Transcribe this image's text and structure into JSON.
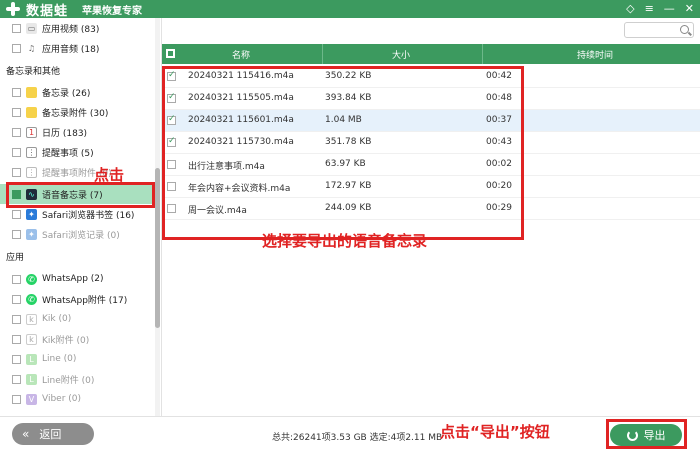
{
  "titlebar": {
    "app_name": "数据蛙",
    "subtitle": "苹果恢复专家",
    "icons": [
      "diamond-icon",
      "menu-icon",
      "minimize-icon",
      "close-icon"
    ]
  },
  "sidebar": {
    "top_items": [
      {
        "label": "应用视频 (83)"
      },
      {
        "label": "应用音频 (18)"
      }
    ],
    "section_memo": "备忘录和其他",
    "memo_items": [
      {
        "label": "备忘录 (26)",
        "gray": false
      },
      {
        "label": "备忘录附件 (30)",
        "gray": false
      },
      {
        "label": "日历 (183)",
        "gray": false
      },
      {
        "label": "提醒事项 (5)",
        "gray": false
      },
      {
        "label": "提醒事项附件 (0)",
        "gray": true
      },
      {
        "label": "语音备忘录 (7)",
        "gray": false,
        "selected": true
      },
      {
        "label": "Safari浏览器书签 (16)",
        "gray": false
      },
      {
        "label": "Safari浏览记录 (0)",
        "gray": true
      }
    ],
    "section_apps": "应用",
    "app_items": [
      {
        "label": "WhatsApp (2)",
        "gray": false
      },
      {
        "label": "WhatsApp附件 (17)",
        "gray": false
      },
      {
        "label": "Kik (0)",
        "gray": true
      },
      {
        "label": "Kik附件 (0)",
        "gray": true
      },
      {
        "label": "Line (0)",
        "gray": true
      },
      {
        "label": "Line附件 (0)",
        "gray": true
      },
      {
        "label": "Viber (0)",
        "gray": true
      }
    ]
  },
  "table": {
    "headers": {
      "name": "名称",
      "size": "大小",
      "duration": "持续时间"
    },
    "rows": [
      {
        "name": "20240321 115416.m4a",
        "size": "350.22 KB",
        "duration": "00:42",
        "checked": true
      },
      {
        "name": "20240321 115505.m4a",
        "size": "393.84 KB",
        "duration": "00:48",
        "checked": true
      },
      {
        "name": "20240321 115601.m4a",
        "size": "1.04 MB",
        "duration": "00:37",
        "checked": true
      },
      {
        "name": "20240321 115730.m4a",
        "size": "351.78 KB",
        "duration": "00:43",
        "checked": true
      },
      {
        "name": "出行注意事项.m4a",
        "size": "63.97 KB",
        "duration": "00:02",
        "checked": false
      },
      {
        "name": "年会内容+会议资料.m4a",
        "size": "172.97 KB",
        "duration": "00:20",
        "checked": false
      },
      {
        "name": "周一会议.m4a",
        "size": "244.09 KB",
        "duration": "00:29",
        "checked": false
      }
    ]
  },
  "annotations": {
    "click": "点击",
    "select": "选择要导出的语音备忘录",
    "export_hint": "点击“导出”按钮"
  },
  "bottombar": {
    "back_label": "返回",
    "stats": "总共:26241项3.53 GB 选定:4项2.11 MB",
    "export_label": "导出"
  },
  "colors": {
    "accent": "#3c9a5f",
    "annotation": "#e02323",
    "selected_row": "#a9e0bf"
  }
}
